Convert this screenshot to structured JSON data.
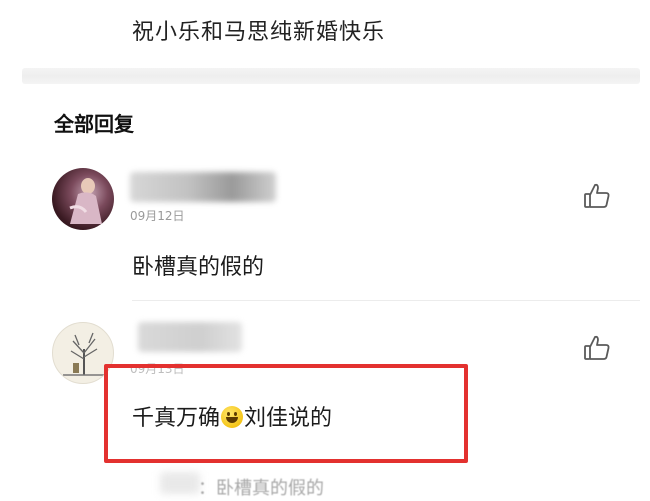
{
  "post": {
    "text": "祝小乐和马思纯新婚快乐"
  },
  "replies_section": {
    "title": "全部回复"
  },
  "comments": [
    {
      "date": "09月12日",
      "text": "卧槽真的假的",
      "avatar": "avatar-person-icon",
      "like_icon": "thumbs-up-icon"
    },
    {
      "date": "09月13日",
      "text_before": "千真万确",
      "emoji": "grinning-face-icon",
      "text_after": "刘佳说的",
      "avatar": "avatar-tree-icon",
      "like_icon": "thumbs-up-icon"
    }
  ],
  "reply_quote": {
    "text": "：卧槽真的假的"
  },
  "colors": {
    "highlight": "#e3312f",
    "date": "#9a9a9a",
    "text": "#1c1c1c"
  }
}
